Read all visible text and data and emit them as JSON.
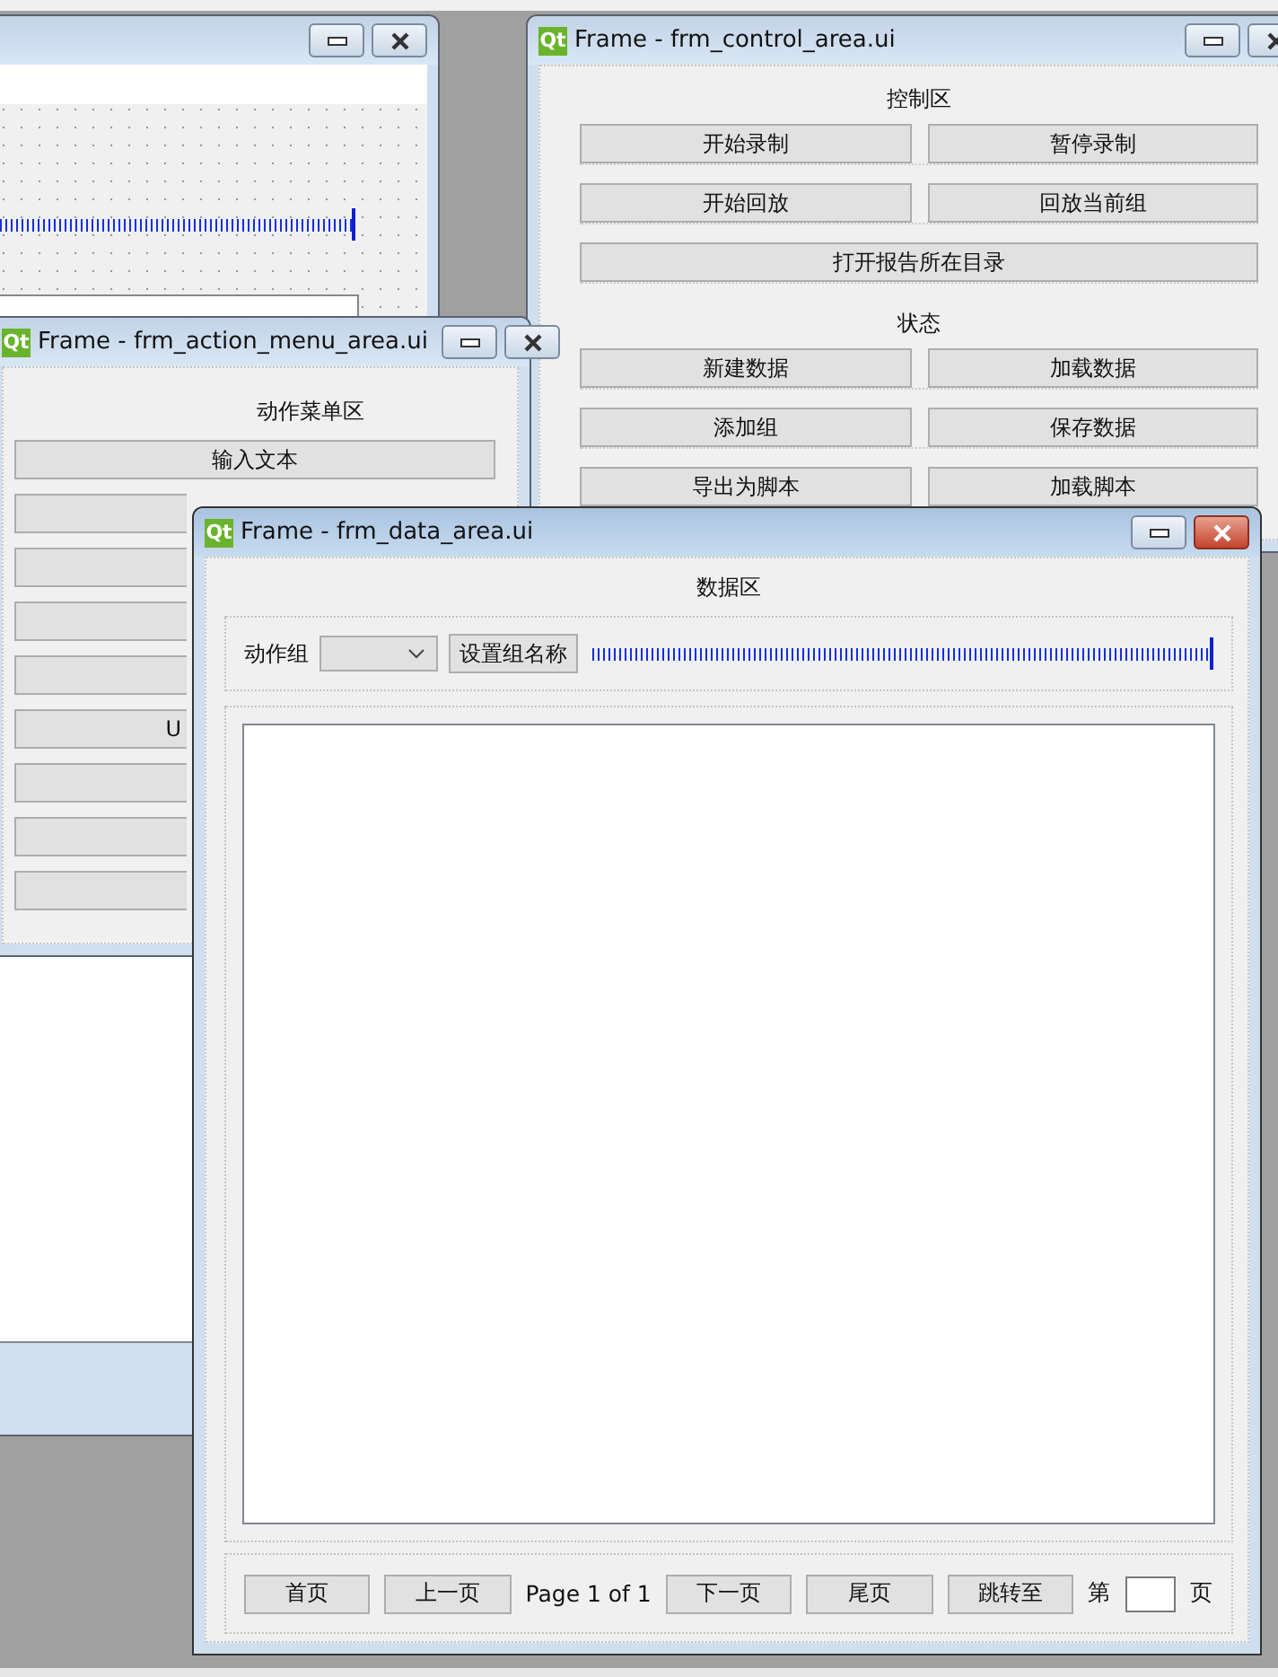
{
  "background_window": {
    "active": false
  },
  "control_window": {
    "logo": "Qt",
    "title": "Frame - frm_control_area.ui",
    "active": false,
    "sections": [
      {
        "heading": "控制区",
        "rows": [
          [
            "开始录制",
            "暂停录制"
          ],
          [
            "开始回放",
            "回放当前组"
          ],
          [
            "打开报告所在目录"
          ]
        ]
      },
      {
        "heading": "状态",
        "rows": [
          [
            "新建数据",
            "加载数据"
          ],
          [
            "添加组",
            "保存数据"
          ],
          [
            "导出为脚本",
            "加载脚本"
          ]
        ]
      }
    ]
  },
  "action_menu_window": {
    "logo": "Qt",
    "title": "Frame - frm_action_menu_area.ui",
    "active": false,
    "heading": "动作菜单区",
    "buttons": [
      {
        "kind": "full",
        "label": "输入文本"
      },
      {
        "kind": "covered"
      },
      {
        "kind": "covered"
      },
      {
        "kind": "covered"
      },
      {
        "kind": "covered"
      },
      {
        "kind": "covered",
        "label": "U"
      },
      {
        "kind": "covered"
      },
      {
        "kind": "covered"
      },
      {
        "kind": "covered"
      }
    ]
  },
  "data_window": {
    "logo": "Qt",
    "title": "Frame - frm_data_area.ui",
    "active": true,
    "heading": "数据区",
    "group_label": "动作组",
    "rename_button": "设置组名称",
    "pager": [
      {
        "kind": "button",
        "text": "首页"
      },
      {
        "kind": "button",
        "text": "上一页"
      },
      {
        "kind": "text",
        "text": "Page 1 of 1"
      },
      {
        "kind": "button",
        "text": "下一页"
      },
      {
        "kind": "button",
        "text": "尾页"
      },
      {
        "kind": "button",
        "text": "跳转至"
      },
      {
        "kind": "text",
        "text": "第"
      },
      {
        "kind": "field"
      },
      {
        "kind": "text",
        "text": "页"
      }
    ]
  }
}
